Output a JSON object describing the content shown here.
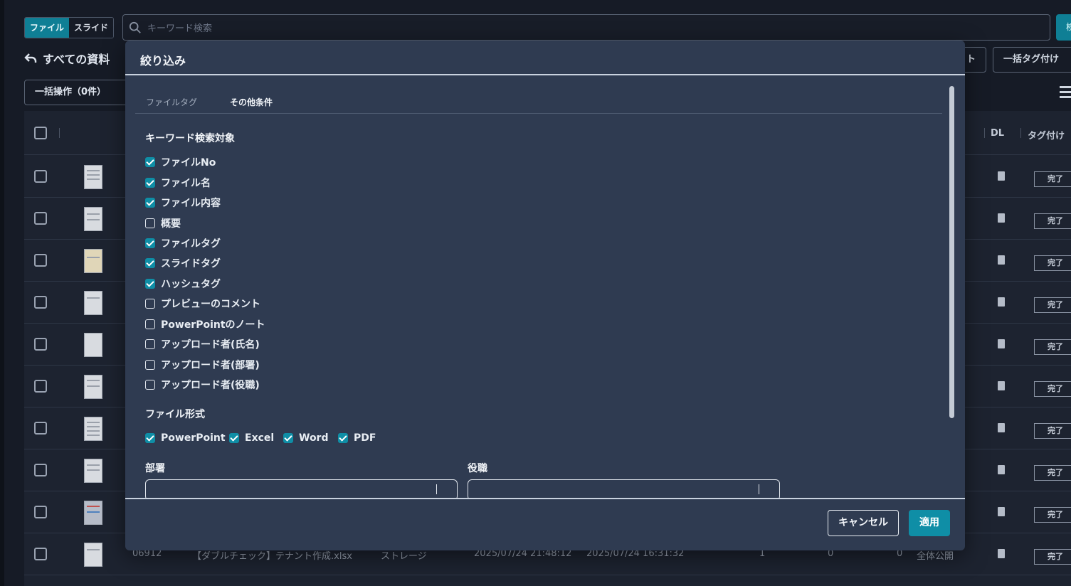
{
  "app": {
    "toggle": [
      "ファイル",
      "スライド"
    ],
    "search_placeholder": "キーワード検索",
    "search_button": "検",
    "breadcrumb": "すべての資料",
    "bulk_label": "一括操作（0件）",
    "bulk_tag_label": "一括タグ付け",
    "partial_button": "ト",
    "headers": {
      "dl": "DL",
      "tag": "タグ付け"
    },
    "done_label": "完了",
    "last_row": {
      "no": "06912",
      "name": "【ダブルチェック】テナント作成.xlsx",
      "storage": "ストレージ",
      "updated": "2025/07/24 21:48:12",
      "created": "2025/07/24 16:31:32",
      "c1": "1",
      "c2": "0",
      "c3": "0",
      "scope": "全体公開"
    }
  },
  "modal": {
    "title": "絞り込み",
    "tabs": [
      "ファイルタグ",
      "その他条件"
    ],
    "keyword_section": "キーワード検索対象",
    "keyword_targets": [
      {
        "label": "ファイルNo",
        "checked": true
      },
      {
        "label": "ファイル名",
        "checked": true
      },
      {
        "label": "ファイル内容",
        "checked": true
      },
      {
        "label": "概要",
        "checked": false
      },
      {
        "label": "ファイルタグ",
        "checked": true
      },
      {
        "label": "スライドタグ",
        "checked": true
      },
      {
        "label": "ハッシュタグ",
        "checked": true
      },
      {
        "label": "プレビューのコメント",
        "checked": false
      },
      {
        "label": "PowerPointのノート",
        "checked": false
      },
      {
        "label": "アップロード者(氏名)",
        "checked": false
      },
      {
        "label": "アップロード者(部署)",
        "checked": false
      },
      {
        "label": "アップロード者(役職)",
        "checked": false
      }
    ],
    "format_section": "ファイル形式",
    "formats": [
      {
        "label": "PowerPoint",
        "checked": true
      },
      {
        "label": "Excel",
        "checked": true
      },
      {
        "label": "Word",
        "checked": true
      },
      {
        "label": "PDF",
        "checked": true
      }
    ],
    "department_label": "部署",
    "position_label": "役職",
    "cancel_label": "キャンセル",
    "apply_label": "適用"
  },
  "colors": {
    "accent": "#0f8ea6",
    "modal_bg": "#2f3b51",
    "page_bg": "#161b26"
  }
}
